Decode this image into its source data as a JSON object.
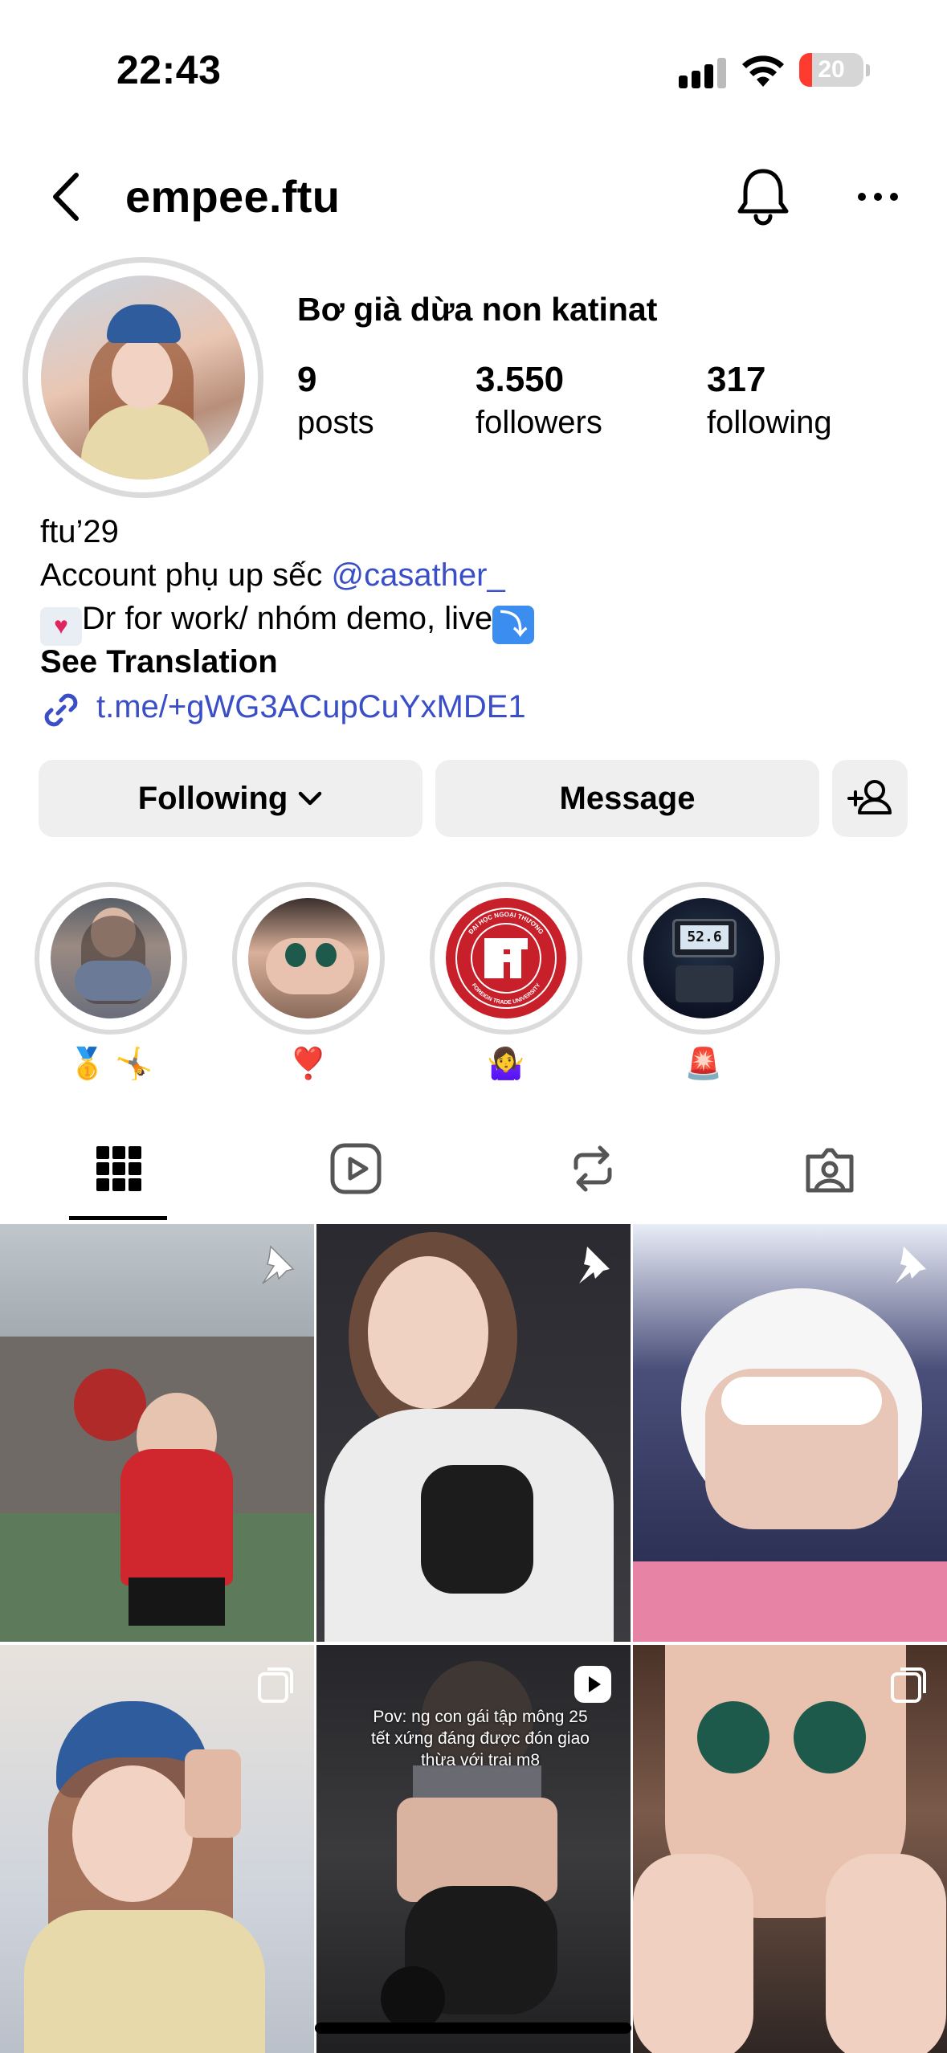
{
  "status_bar": {
    "time": "22:43",
    "battery_level": "20",
    "battery_fraction": 0.2
  },
  "header": {
    "username": "empee.ftu"
  },
  "profile": {
    "display_name": "Bơ già dừa non katinat",
    "stats": [
      {
        "value": "9",
        "label": "posts"
      },
      {
        "value": "3.550",
        "label": "followers"
      },
      {
        "value": "317",
        "label": "following"
      }
    ],
    "bio": {
      "line1": "ftu’29",
      "line2_prefix": "Account phụ up sếc ",
      "line2_mention": "@casather_",
      "line3_text": "Dr for work/ nhóm demo, live",
      "see_translation": "See Translation",
      "link": "t.me/+gWG3ACupCuYxMDE1"
    }
  },
  "actions": {
    "following_label": "Following",
    "message_label": "Message"
  },
  "highlights": [
    {
      "label": "🥇 🤸"
    },
    {
      "label": "❣️"
    },
    {
      "label": "🤷‍♀️"
    },
    {
      "label": "🚨"
    }
  ],
  "highlight_seal_text": "ĐẠI HỌC NGOẠI THƯƠNG · FOREIGN TRADE UNIVERSITY",
  "highlight_display_reading": "52.6",
  "posts": [
    {
      "badge": "pin-icon",
      "caption": ""
    },
    {
      "badge": "pin-icon",
      "caption": ""
    },
    {
      "badge": "pin-icon",
      "caption": ""
    },
    {
      "badge": "carousel-icon",
      "caption": ""
    },
    {
      "badge": "reel-icon",
      "caption": "Pov: ng con gái tập mông 25 tết xứng đáng được đón giao thừa với trai m8"
    },
    {
      "badge": "carousel-icon",
      "caption": ""
    }
  ],
  "icons": {
    "back": "chevron-left-icon",
    "bell": "bell-icon",
    "more": "more-horizontal-icon",
    "add_user": "add-user-icon",
    "link": "link-icon",
    "tabs": [
      "grid-icon",
      "reels-icon",
      "reposts-icon",
      "tagged-icon"
    ]
  },
  "colors": {
    "link": "#3a4ec8",
    "button_bg": "#efefef",
    "ring": "#dbdbdb",
    "battery_low": "#ff3b30"
  }
}
